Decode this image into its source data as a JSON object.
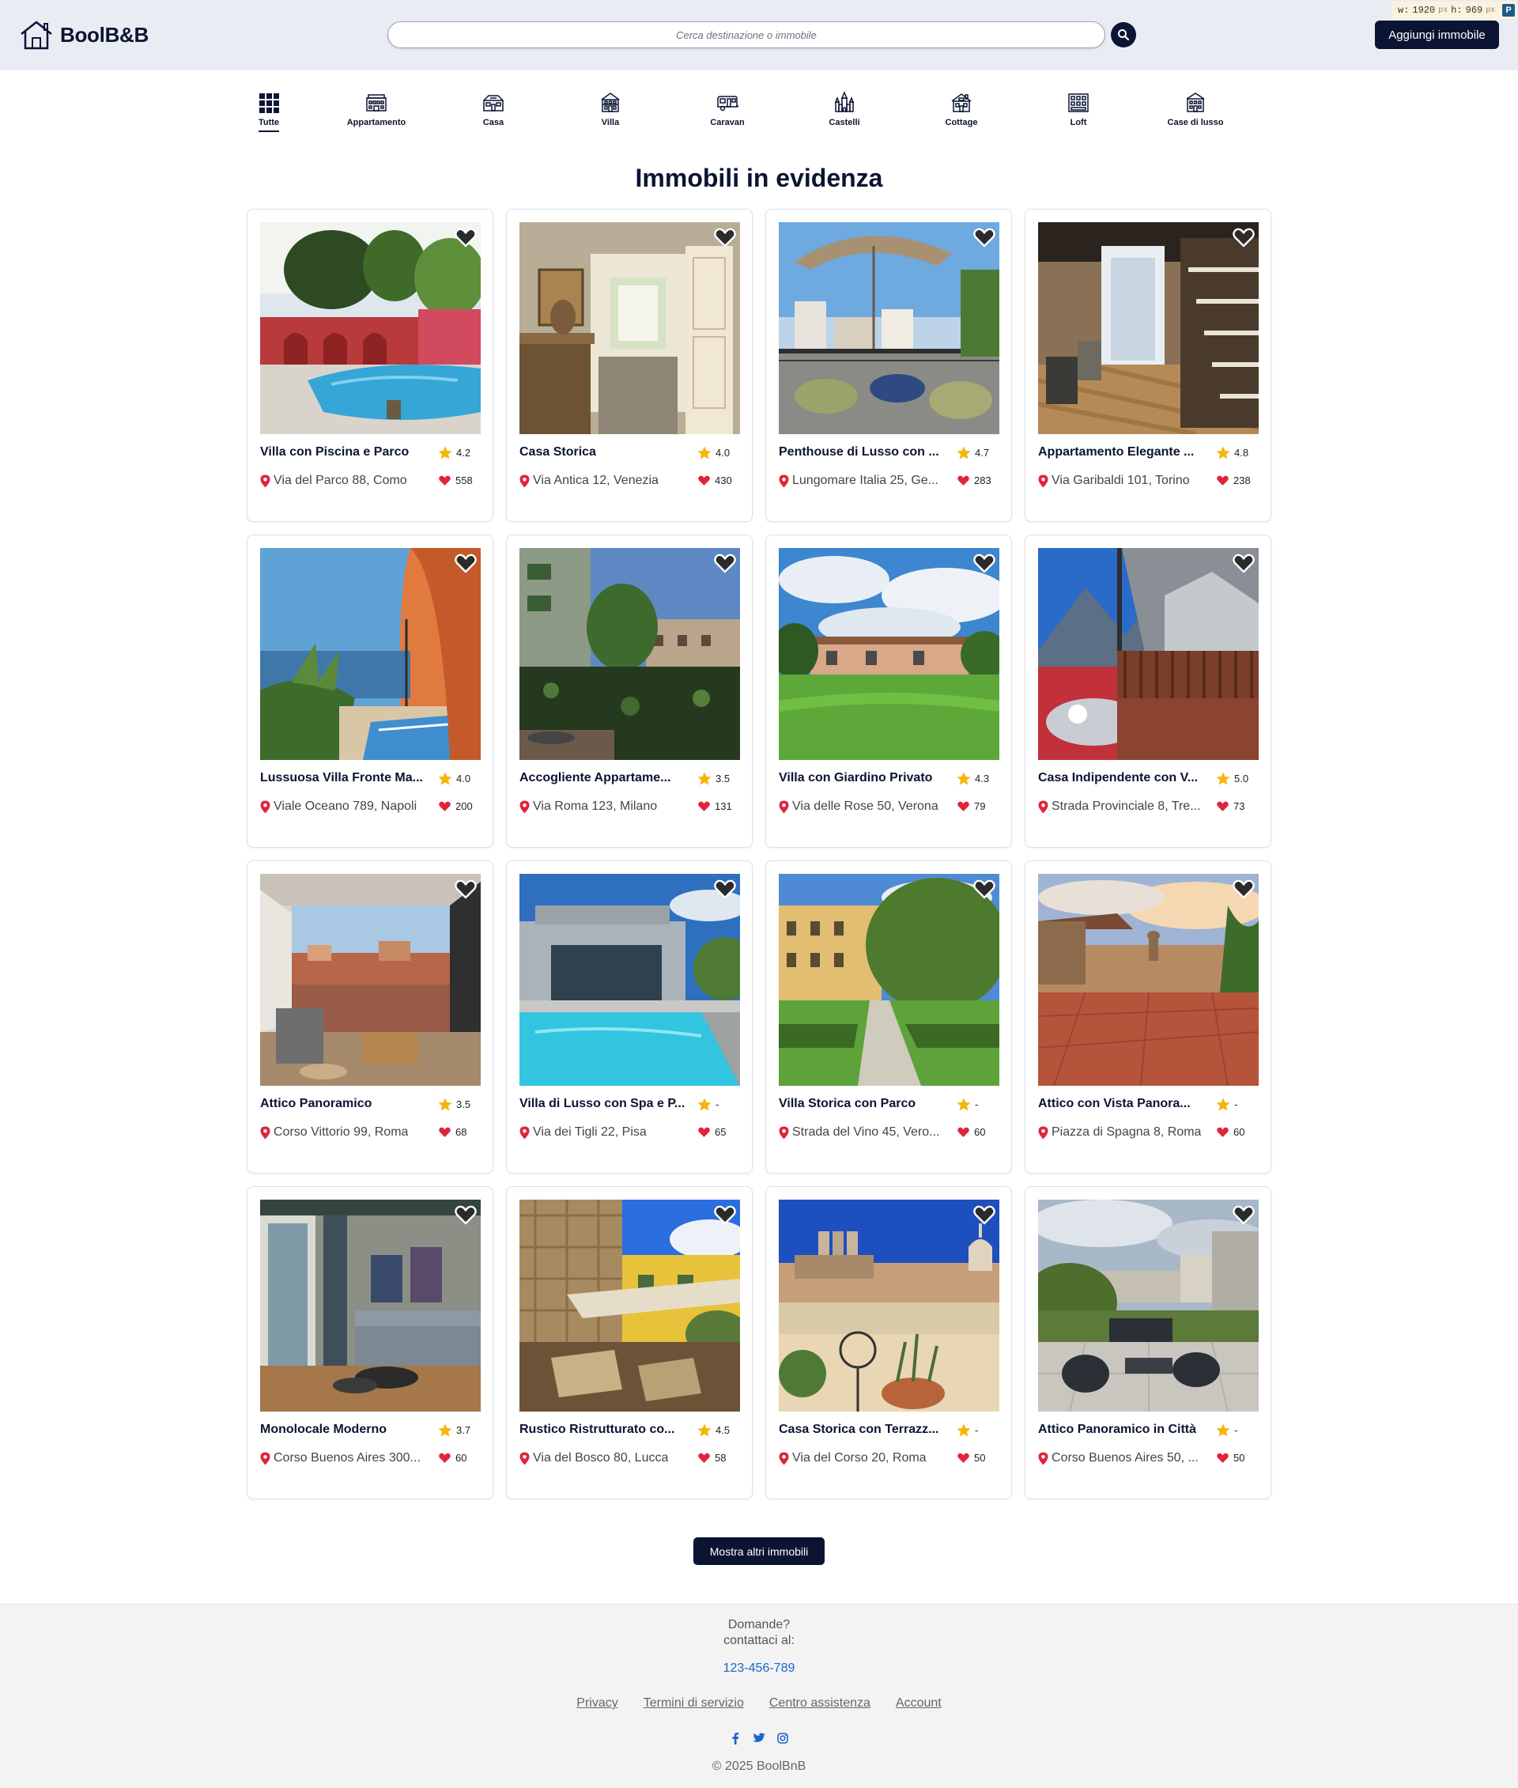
{
  "header": {
    "brand": "BoolB&B",
    "search_placeholder": "Cerca destinazione o immobile",
    "add_button": "Aggiungi immobile"
  },
  "dim_badge": {
    "w_label": "w:",
    "w_value": "1920",
    "h_label": "h:",
    "h_value": "969",
    "unit": "px",
    "icon": "P"
  },
  "categories": [
    {
      "label": "Tutte",
      "icon": "grid-icon",
      "active": true
    },
    {
      "label": "Appartamento",
      "icon": "apartment-icon"
    },
    {
      "label": "Casa",
      "icon": "house-icon"
    },
    {
      "label": "Villa",
      "icon": "villa-icon"
    },
    {
      "label": "Caravan",
      "icon": "caravan-icon"
    },
    {
      "label": "Castelli",
      "icon": "castle-icon"
    },
    {
      "label": "Cottage",
      "icon": "cottage-icon"
    },
    {
      "label": "Loft",
      "icon": "loft-icon"
    },
    {
      "label": "Case di lusso",
      "icon": "luxury-house-icon"
    }
  ],
  "section_title": "Immobili in evidenza",
  "properties": [
    {
      "title": "Villa con Piscina e Parco",
      "rating": "4.2",
      "address": "Via del Parco 88, Como",
      "likes": "558",
      "scene": "pool-villa"
    },
    {
      "title": "Casa Storica",
      "rating": "4.0",
      "address": "Via Antica 12, Venezia",
      "likes": "430",
      "scene": "interior"
    },
    {
      "title": "Penthouse di Lusso con ...",
      "rating": "4.7",
      "address": "Lungomare Italia 25, Ge...",
      "likes": "283",
      "scene": "terrace"
    },
    {
      "title": "Appartamento Elegante ...",
      "rating": "4.8",
      "address": "Via Garibaldi 101, Torino",
      "likes": "238",
      "scene": "loft-interior"
    },
    {
      "title": "Lussuosa Villa Fronte Ma...",
      "rating": "4.0",
      "address": "Viale Oceano 789, Napoli",
      "likes": "200",
      "scene": "sea-arch"
    },
    {
      "title": "Accogliente Appartame...",
      "rating": "3.5",
      "address": "Via Roma 123, Milano",
      "likes": "131",
      "scene": "balcony-green"
    },
    {
      "title": "Villa con Giardino Privato",
      "rating": "4.3",
      "address": "Via delle Rose 50, Verona",
      "likes": "79",
      "scene": "garden-villa"
    },
    {
      "title": "Casa Indipendente con V...",
      "rating": "5.0",
      "address": "Strada Provinciale 8, Tre...",
      "likes": "73",
      "scene": "mountain-balcony"
    },
    {
      "title": "Attico Panoramico",
      "rating": "3.5",
      "address": "Corso Vittorio 99, Roma",
      "likes": "68",
      "scene": "room-view"
    },
    {
      "title": "Villa di Lusso con Spa e P...",
      "rating": "-",
      "address": "Via dei Tigli 22, Pisa",
      "likes": "65",
      "scene": "modern-pool"
    },
    {
      "title": "Villa Storica con Parco",
      "rating": "-",
      "address": "Strada del Vino 45, Vero...",
      "likes": "60",
      "scene": "historic-park"
    },
    {
      "title": "Attico con Vista Panora...",
      "rating": "-",
      "address": "Piazza di Spagna 8, Roma",
      "likes": "60",
      "scene": "sunset-terrace"
    },
    {
      "title": "Monolocale Moderno",
      "rating": "3.7",
      "address": "Corso Buenos Aires 300...",
      "likes": "60",
      "scene": "living-room"
    },
    {
      "title": "Rustico Ristrutturato co...",
      "rating": "4.5",
      "address": "Via del Bosco 80, Lucca",
      "likes": "58",
      "scene": "rustic"
    },
    {
      "title": "Casa Storica con Terrazz...",
      "rating": "-",
      "address": "Via del Corso 20, Roma",
      "likes": "50",
      "scene": "rome-terrace"
    },
    {
      "title": "Attico Panoramico in Città",
      "rating": "-",
      "address": "Corso Buenos Aires 50, ...",
      "likes": "50",
      "scene": "city-terrace"
    }
  ],
  "more_button": "Mostra altri immobili",
  "footer": {
    "question_line1": "Domande?",
    "question_line2": "contattaci al:",
    "phone": "123-456-789",
    "links": [
      "Privacy",
      "Termini di servizio",
      "Centro assistenza",
      "Account"
    ],
    "social": [
      "facebook-icon",
      "twitter-icon",
      "instagram-icon"
    ],
    "copyright": "© 2025 BoolBnB"
  },
  "colors": {
    "primary": "#0b1433",
    "accent_star": "#f5b50a",
    "heart": "#e0243b",
    "link": "#1d64c8"
  }
}
